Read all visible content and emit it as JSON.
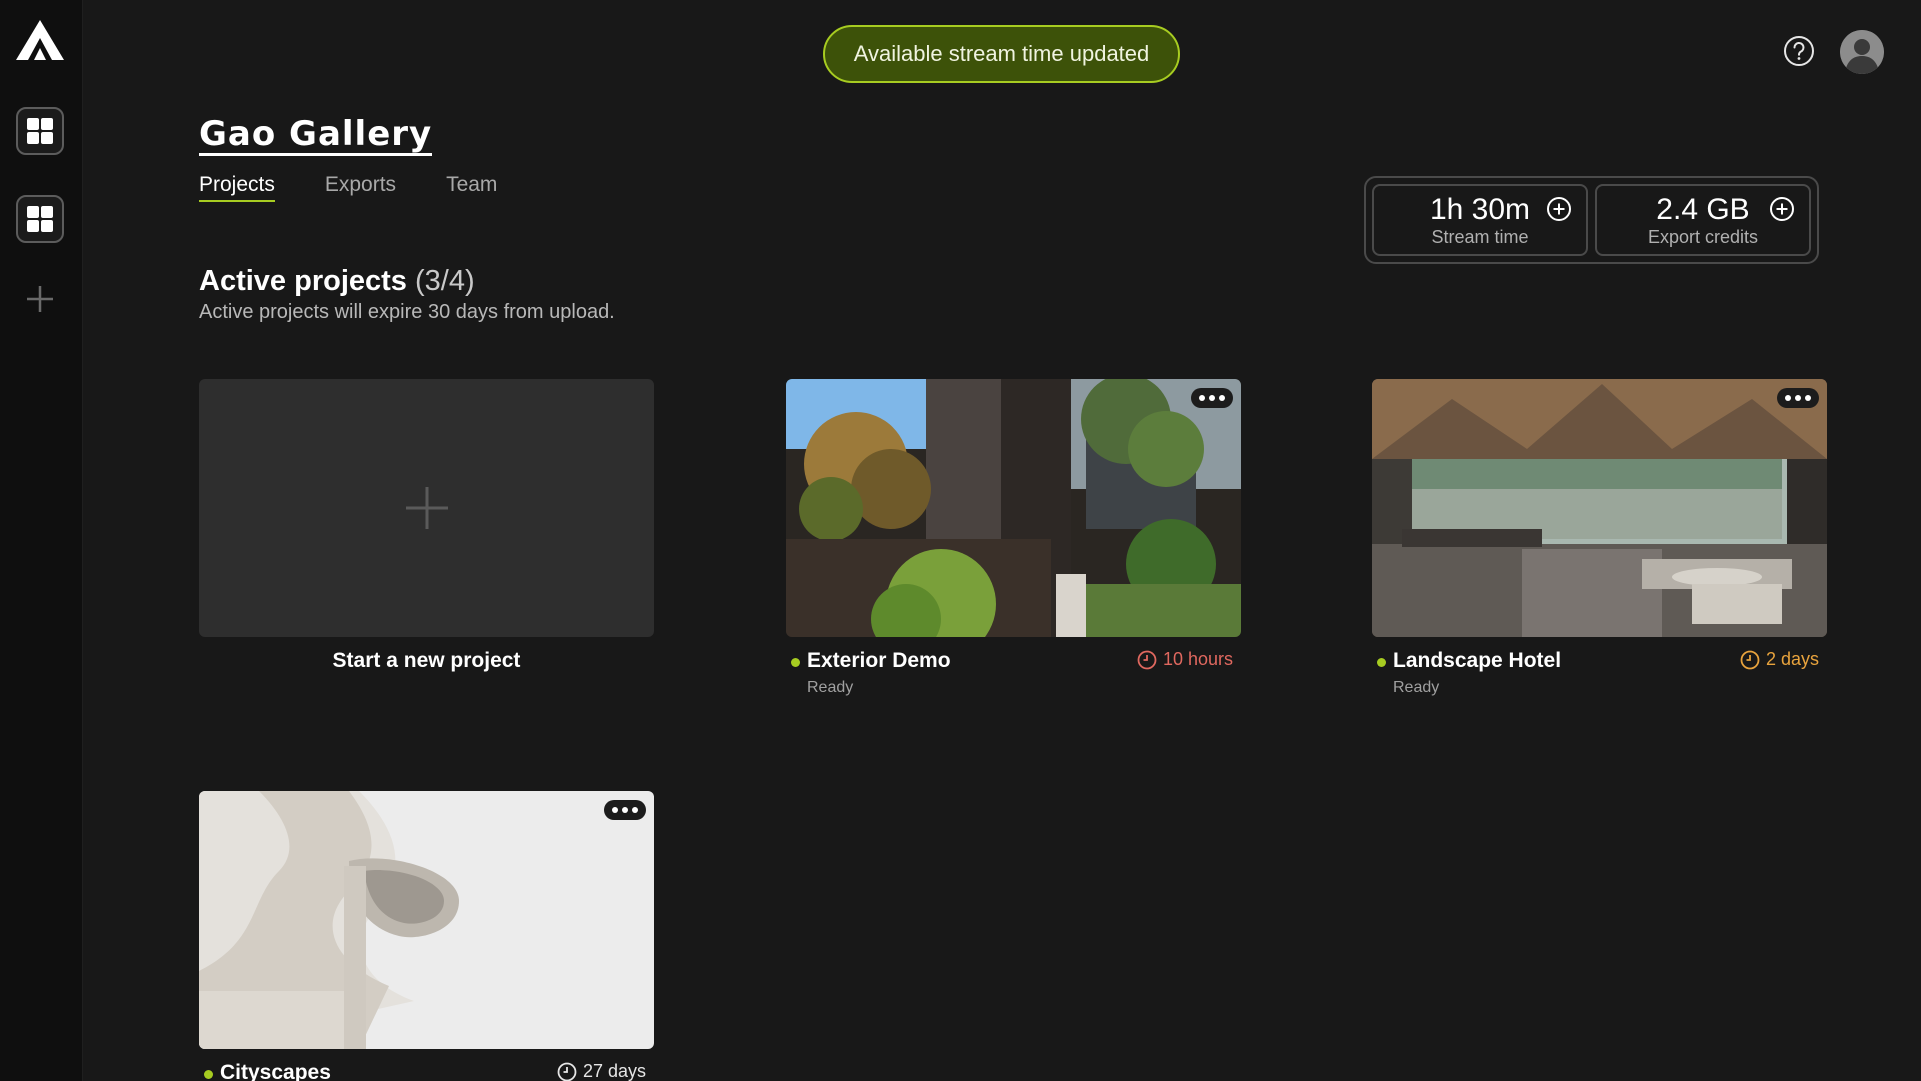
{
  "toast": {
    "message": "Available stream time updated",
    "color": "#a7cc21"
  },
  "header": {
    "help_icon": "question-circle-icon",
    "avatar_icon": "user-avatar-icon"
  },
  "sidebar": {
    "logo": "app-logo",
    "items": [
      {
        "icon": "grid-icon"
      },
      {
        "icon": "grid-icon"
      },
      {
        "icon": "plus-icon"
      }
    ]
  },
  "gallery": {
    "title": "Gao Gallery",
    "tabs": [
      {
        "label": "Projects",
        "active": true
      },
      {
        "label": "Exports",
        "active": false
      },
      {
        "label": "Team",
        "active": false
      }
    ]
  },
  "credits": {
    "stream": {
      "value": "1h 30m",
      "label": "Stream time"
    },
    "export": {
      "value": "2.4 GB",
      "label": "Export credits"
    }
  },
  "section": {
    "title": "Active projects",
    "count": "(3/4)",
    "subtitle": "Active projects will expire 30 days from upload."
  },
  "new_project": {
    "label": "Start a new project"
  },
  "projects": [
    {
      "name": "Exterior Demo",
      "status": "Ready",
      "expiry": "10 hours",
      "expiry_color": "#e0685f"
    },
    {
      "name": "Landscape Hotel",
      "status": "Ready",
      "expiry": "2 days",
      "expiry_color": "#e8a33d"
    },
    {
      "name": "Cityscapes",
      "status": "",
      "expiry": "27 days",
      "expiry_color": "#e6e6e6"
    }
  ]
}
